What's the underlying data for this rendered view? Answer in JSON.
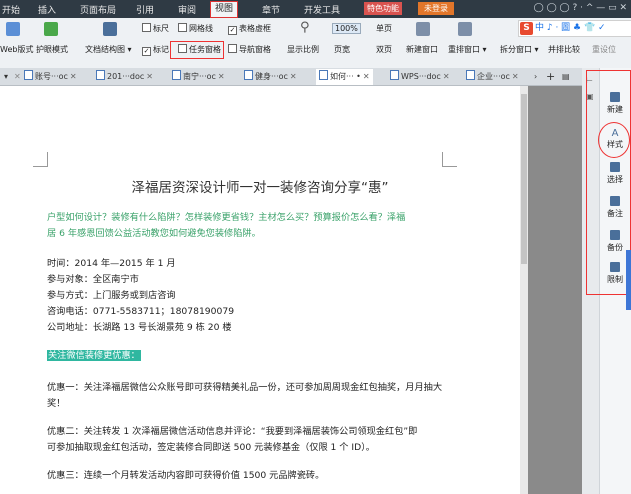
{
  "menubar": {
    "items": [
      {
        "label": "开始"
      },
      {
        "label": "插入"
      },
      {
        "label": "页面布局"
      },
      {
        "label": "引用"
      },
      {
        "label": "审阅"
      },
      {
        "label": "视图"
      },
      {
        "label": "章节"
      },
      {
        "label": "开发工具"
      }
    ],
    "special": "特色功能",
    "login": "未登录",
    "icons_text": "◯ ◯ ◯ ? · ^ — ▭ ✕"
  },
  "ribbon": {
    "web_view": "Web版式",
    "eye_mode": "护眼模式",
    "nav_pane": "文档结构图",
    "ruler": "标尺",
    "gridlines": "网格线",
    "table_lines": "表格虚框",
    "mark": "标记",
    "task_pane": "任务窗格",
    "nav_window": "导航窗格",
    "zoom_label": "显示比例",
    "zoom_value": "100%",
    "single_page": "单页",
    "page_width": "页宽",
    "two_pages": "双页",
    "new_window": "新建窗口",
    "arrange": "重排窗口",
    "split": "拆分窗口",
    "side_by_side": "并排比较",
    "sync": "重设位"
  },
  "ime": {
    "logo": "S",
    "text": "中 ♪ ⋅ 圖 ♣ 👕 ✓"
  },
  "tabs": [
    {
      "label": "账号···oc"
    },
    {
      "label": "201···doc"
    },
    {
      "label": "南宁···oc"
    },
    {
      "label": "健身···oc"
    },
    {
      "label": "如何··· •"
    },
    {
      "label": "WPS···doc"
    },
    {
      "label": "企业···oc"
    }
  ],
  "document": {
    "title": "泽福居资深设计师一对一装修咨询分享“惠”",
    "intro_1": "户型如何设计？装修有什么陷阱？怎样装修更省钱？主材怎么买？预算报价怎么看？泽福",
    "intro_2": "居 6 年感恩回馈公益活动教您如何避免您装修陷阱。",
    "time": "时间：2014 年—2015 年 1 月",
    "audience": "参与对象：全区南宁市",
    "method": "参与方式：上门服务或到店咨询",
    "phone": "咨询电话：0771-5583711；18078190079",
    "address": "公司地址：长湖路 13 号长湖景苑 9 栋 20 楼",
    "wechat": "关注微信装修更优惠：",
    "offer1_1": "优惠一：关注泽福居微信公众账号即可获得精美礼品一份，还可参加周周现金红包抽奖，月月抽大",
    "offer1_2": "奖！",
    "offer2_1": "优惠二：关注转发 1 次泽福居微信活动信息并评论：“我要到泽福居装饰公司领现金红包”即",
    "offer2_2": "可参加抽取现金红包活动，签定装修合同即送 500 元装修基金（仅限 1 个 ID）。",
    "offer3": "优惠三：连续一个月转发活动内容即可获得价值 1500 元品牌瓷砖。"
  },
  "sidepanel": {
    "new": "新建",
    "style": "样式",
    "select": "选择",
    "note": "备注",
    "backup": "备份",
    "limit": "限制"
  }
}
